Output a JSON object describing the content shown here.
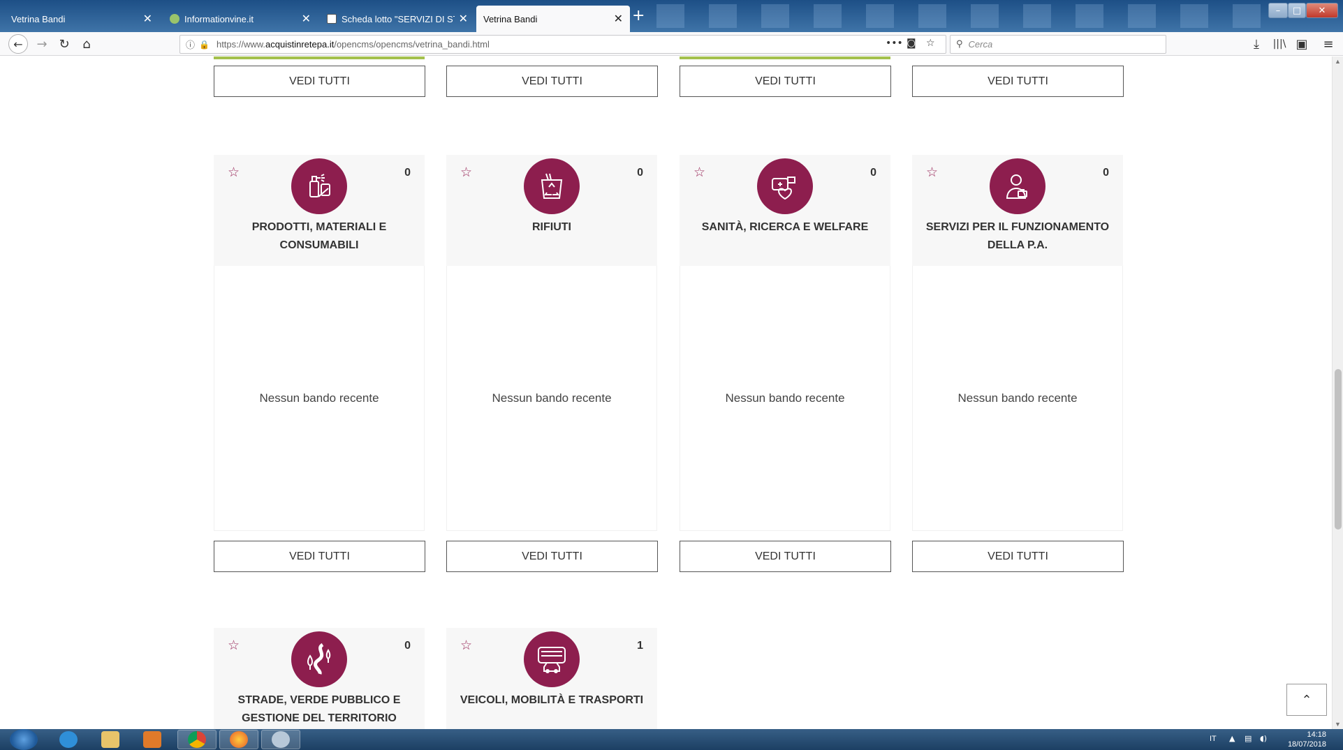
{
  "browser": {
    "tabs": [
      {
        "label": "Vetrina Bandi",
        "active": false
      },
      {
        "label": "Informationvine.it",
        "active": false
      },
      {
        "label": "Scheda lotto \"SERVIZI DI STAMP",
        "active": false
      },
      {
        "label": "Vetrina Bandi",
        "active": true
      }
    ],
    "url_prefix": "https://www.",
    "url_domain": "acquistinretepa.it",
    "url_path": "/opencms/opencms/vetrina_bandi.html",
    "search_placeholder": "Cerca"
  },
  "page": {
    "top_buttons": [
      "VEDI TUTTI",
      "VEDI TUTTI",
      "VEDI TUTTI",
      "VEDI TUTTI"
    ],
    "cards": [
      {
        "title": "PRODOTTI, MATERIALI E CONSUMABILI",
        "count": "0",
        "empty_text": "Nessun bando recente",
        "button": "VEDI TUTTI",
        "icon": "cleaning-products-icon"
      },
      {
        "title": "RIFIUTI",
        "count": "0",
        "empty_text": "Nessun bando recente",
        "button": "VEDI TUTTI",
        "icon": "recycle-bin-icon"
      },
      {
        "title": "SANITÀ, RICERCA E WELFARE",
        "count": "0",
        "empty_text": "Nessun bando recente",
        "button": "VEDI TUTTI",
        "icon": "medical-kit-heart-icon"
      },
      {
        "title": "SERVIZI PER IL FUNZIONAMENTO DELLA P.A.",
        "count": "0",
        "empty_text": "Nessun bando recente",
        "button": "VEDI TUTTI",
        "icon": "office-worker-icon"
      },
      {
        "title": "STRADE, VERDE PUBBLICO E GESTIONE DEL TERRITORIO",
        "count": "0",
        "icon": "road-trees-icon"
      },
      {
        "title": "VEICOLI, MOBILITÀ E TRASPORTI",
        "count": "1",
        "icon": "bus-car-icon"
      }
    ]
  },
  "taskbar": {
    "language": "IT",
    "time": "14:18",
    "date": "18/07/2018"
  },
  "colors": {
    "accent": "#8d1e4e",
    "green_bar": "#a4c14d"
  }
}
